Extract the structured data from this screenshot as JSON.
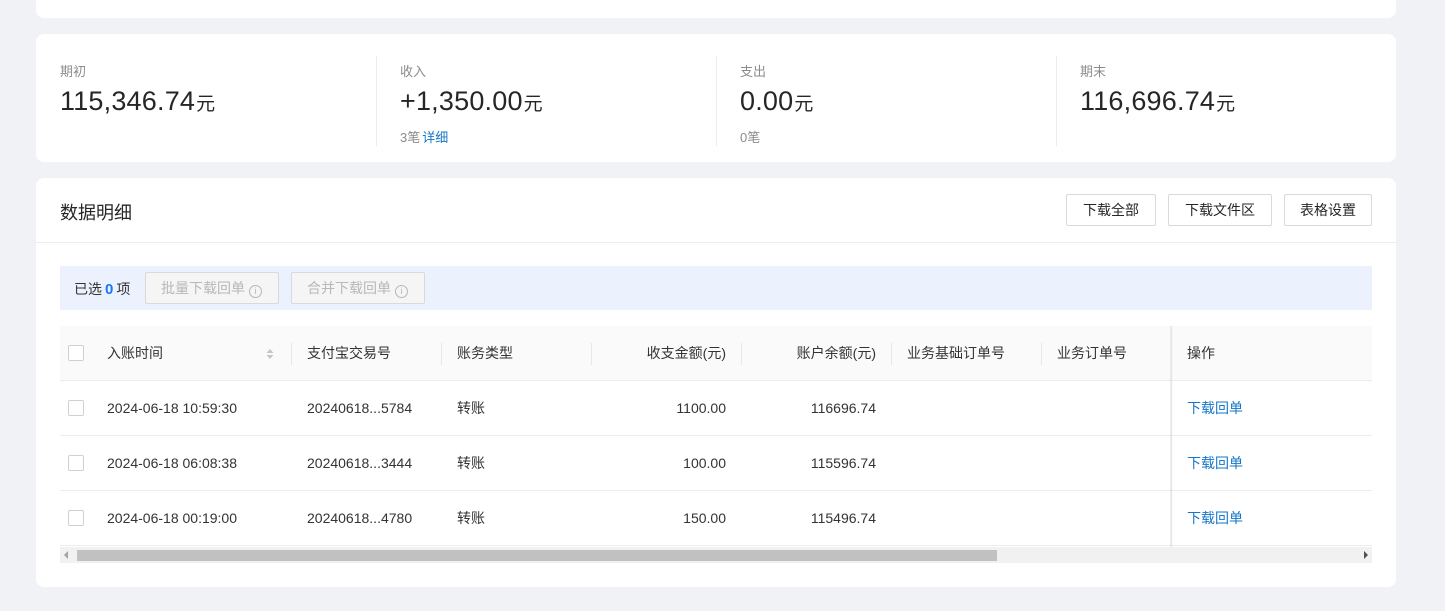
{
  "summary": [
    {
      "label": "期初",
      "value": "115,346.74",
      "unit": "元",
      "sub_count": "",
      "sub_link": ""
    },
    {
      "label": "收入",
      "value": "+1,350.00",
      "unit": "元",
      "sub_count": "3笔",
      "sub_link": "详细"
    },
    {
      "label": "支出",
      "value": "0.00",
      "unit": "元",
      "sub_count": "0笔",
      "sub_link": ""
    },
    {
      "label": "期末",
      "value": "116,696.74",
      "unit": "元",
      "sub_count": "",
      "sub_link": ""
    }
  ],
  "detail": {
    "title": "数据明细",
    "buttons": {
      "download_all": "下载全部",
      "download_area": "下载文件区",
      "table_settings": "表格设置"
    }
  },
  "selection": {
    "prefix": "已选",
    "count": "0",
    "suffix": "项",
    "batch_download": "批量下载回单",
    "merge_download": "合并下载回单"
  },
  "table": {
    "headers": {
      "time": "入账时间",
      "trade_no": "支付宝交易号",
      "type": "账务类型",
      "amount": "收支金额(元)",
      "balance": "账户余额(元)",
      "base_order": "业务基础订单号",
      "order": "业务订单号",
      "op": "操作"
    },
    "rows": [
      {
        "time": "2024-06-18 10:59:30",
        "trade_no": "20240618...5784",
        "type": "转账",
        "amount": "1100.00",
        "balance": "116696.74",
        "base_order": "",
        "order": "",
        "op": "下载回单"
      },
      {
        "time": "2024-06-18 06:08:38",
        "trade_no": "20240618...3444",
        "type": "转账",
        "amount": "100.00",
        "balance": "115596.74",
        "base_order": "",
        "order": "",
        "op": "下载回单"
      },
      {
        "time": "2024-06-18 00:19:00",
        "trade_no": "20240618...4780",
        "type": "转账",
        "amount": "150.00",
        "balance": "115496.74",
        "base_order": "",
        "order": "",
        "op": "下载回单"
      }
    ]
  },
  "scrollbar": {
    "thumb_fraction": 0.72
  },
  "colors": {
    "link": "#1677c8",
    "accent": "#1677ff",
    "selection_bg": "#ebf2fe"
  },
  "icons": {
    "sort": "sort-icon",
    "info": "info-icon",
    "scroll_left": "arrow-left-icon",
    "scroll_right": "arrow-right-icon"
  }
}
